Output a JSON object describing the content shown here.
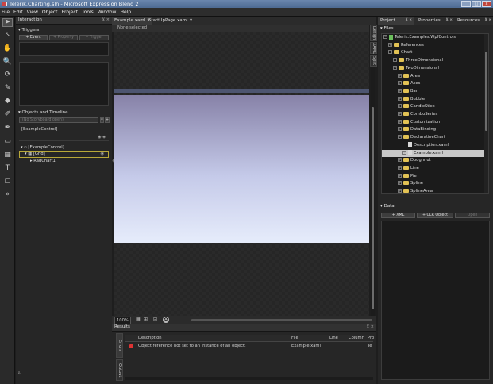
{
  "window": {
    "title": "Telerik.Charting.sln - Microsoft Expression Blend 2",
    "btn_min": "_",
    "btn_max": "□",
    "btn_close": "x"
  },
  "menu": [
    "File",
    "Edit",
    "View",
    "Object",
    "Project",
    "Tools",
    "Window",
    "Help"
  ],
  "tools": [
    {
      "name": "selection-arrow-icon",
      "glyph": "➤"
    },
    {
      "name": "direct-select-icon",
      "glyph": "↖"
    },
    {
      "name": "pan-hand-icon",
      "glyph": "✋"
    },
    {
      "name": "zoom-icon",
      "glyph": "🔍"
    },
    {
      "name": "camera-orbit-icon",
      "glyph": "⟳"
    },
    {
      "name": "eyedropper-icon",
      "glyph": "✎"
    },
    {
      "name": "paint-bucket-icon",
      "glyph": "◆"
    },
    {
      "name": "brush-transform-icon",
      "glyph": "✐"
    },
    {
      "name": "pen-icon",
      "glyph": "✒"
    },
    {
      "name": "rectangle-icon",
      "glyph": "▭"
    },
    {
      "name": "grid-layout-icon",
      "glyph": "▦"
    },
    {
      "name": "text-tool-icon",
      "glyph": "T"
    },
    {
      "name": "controls-icon",
      "glyph": "☐"
    },
    {
      "name": "asset-library-icon",
      "glyph": "»"
    }
  ],
  "interaction": {
    "header": "Interaction",
    "pin": "⊻ ×",
    "triggers_title": "Triggers",
    "btn_event": "+ Event",
    "btn_property": "+ Property",
    "btn_trigger": "− Trigger",
    "objects_title": "Objects and Timeline",
    "storyboard": "(No Storyboard open)",
    "sb_btn1": "▾",
    "sb_btn2": "+",
    "root_item": "[ExampleControl]",
    "tree": [
      {
        "label": "[ExampleControl]",
        "indent": 0
      },
      {
        "label": "[Grid]",
        "indent": 1
      },
      {
        "label": "RadChart1",
        "indent": 2
      }
    ]
  },
  "editor": {
    "tabs": [
      {
        "label": "Example.xaml",
        "close": "×"
      },
      {
        "label": "StartUpPage.xaml",
        "close": "×"
      }
    ],
    "breadcrumb": "None selected",
    "view_tabs": [
      "Design",
      "XAML",
      "Split"
    ],
    "zoom": "100%"
  },
  "results": {
    "header": "Results",
    "pin": "⊻ ×",
    "side_tabs": [
      "Errors",
      "Output"
    ],
    "columns": [
      "Description",
      "File",
      "Line",
      "Column",
      "Pro"
    ],
    "rows": [
      {
        "description": "Object reference not set to an instance of an object.",
        "file": "Example.xaml",
        "line": "",
        "column": "",
        "project": "Te"
      }
    ]
  },
  "right_tabs": [
    {
      "label": "Project",
      "pin": "⊻ ×"
    },
    {
      "label": "Properties",
      "pin": "⊻ ×"
    },
    {
      "label": "Resources",
      "pin": "⊻ ×"
    }
  ],
  "files": {
    "title": "Files",
    "tree": [
      {
        "label": "Telerik.Examples.WpfControls",
        "indent": 0,
        "type": "project",
        "expander": "−"
      },
      {
        "label": "References",
        "indent": 1,
        "type": "folder",
        "expander": "+"
      },
      {
        "label": "Chart",
        "indent": 1,
        "type": "folder",
        "expander": "−"
      },
      {
        "label": "ThreeDimensional",
        "indent": 2,
        "type": "folder",
        "expander": "+"
      },
      {
        "label": "TwoDimensional",
        "indent": 2,
        "type": "folder",
        "expander": "−"
      },
      {
        "label": "Area",
        "indent": 3,
        "type": "folder",
        "expander": "+"
      },
      {
        "label": "Axes",
        "indent": 3,
        "type": "folder",
        "expander": "+"
      },
      {
        "label": "Bar",
        "indent": 3,
        "type": "folder",
        "expander": "+"
      },
      {
        "label": "Bubble",
        "indent": 3,
        "type": "folder",
        "expander": "+"
      },
      {
        "label": "CandleStick",
        "indent": 3,
        "type": "folder",
        "expander": "+"
      },
      {
        "label": "ComboSeries",
        "indent": 3,
        "type": "folder",
        "expander": "+"
      },
      {
        "label": "Customization",
        "indent": 3,
        "type": "folder",
        "expander": "+"
      },
      {
        "label": "DataBinding",
        "indent": 3,
        "type": "folder",
        "expander": "+"
      },
      {
        "label": "DeclarativeChart",
        "indent": 3,
        "type": "folder",
        "expander": "−"
      },
      {
        "label": "Description.xaml",
        "indent": 4,
        "type": "file",
        "expander": ""
      },
      {
        "label": "Example.xaml",
        "indent": 4,
        "type": "file",
        "expander": "+",
        "selected": true
      },
      {
        "label": "Doughnut",
        "indent": 3,
        "type": "folder",
        "expander": "+"
      },
      {
        "label": "Line",
        "indent": 3,
        "type": "folder",
        "expander": "+"
      },
      {
        "label": "Pie",
        "indent": 3,
        "type": "folder",
        "expander": "+"
      },
      {
        "label": "Spline",
        "indent": 3,
        "type": "folder",
        "expander": "+"
      },
      {
        "label": "SplineArea",
        "indent": 3,
        "type": "folder",
        "expander": "+"
      }
    ]
  },
  "data_panel": {
    "title": "Data",
    "btn_xml": "+ XML",
    "btn_clr": "+ CLR Object",
    "btn_other": "Open"
  }
}
